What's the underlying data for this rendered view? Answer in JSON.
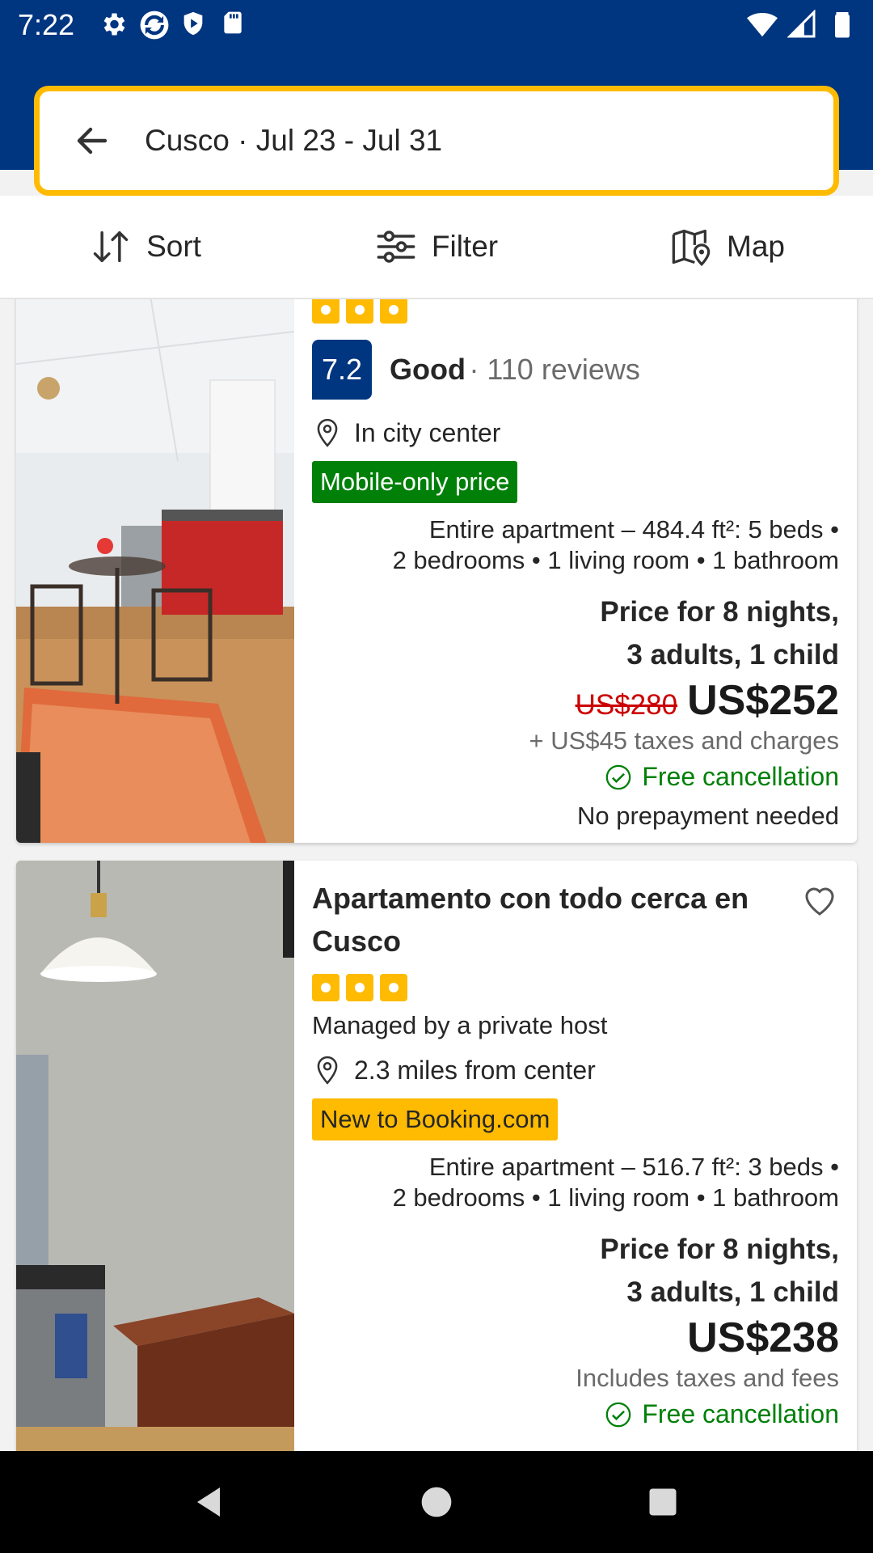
{
  "status_bar": {
    "time": "7:22",
    "left_icons": [
      "settings-icon",
      "sync-icon",
      "shield-icon",
      "sd-card-icon"
    ],
    "right_icons": [
      "wifi-icon",
      "signal-icon",
      "battery-icon"
    ]
  },
  "search": {
    "value": "Cusco · Jul 23 - Jul 31"
  },
  "toolbar": {
    "sort_label": "Sort",
    "filter_label": "Filter",
    "map_label": "Map"
  },
  "colors": {
    "brand_blue": "#003580",
    "accent_yellow": "#febb02",
    "green": "#008009",
    "red": "#cc0000"
  },
  "listings": [
    {
      "stars": 3,
      "score": "7.2",
      "score_word": "Good",
      "reviews": "· 110 reviews",
      "location": "In city center",
      "badge": "Mobile-only price",
      "details_line1": "Entire apartment – 484.4 ft²: 5 beds •",
      "details_line2": "2 bedrooms • 1 living room • 1 bathroom",
      "price_for_line1": "Price for 8 nights,",
      "price_for_line2": "3 adults, 1 child",
      "old_price": "US$280",
      "price": "US$252",
      "taxes": "+ US$45 taxes and charges",
      "cancellation": "Free cancellation",
      "prepayment": "No prepayment needed"
    },
    {
      "title": "Apartamento con todo cerca en Cusco",
      "stars": 3,
      "managed_by": "Managed by a private host",
      "location": "2.3 miles from center",
      "badge": "New to Booking.com",
      "details_line1": "Entire apartment – 516.7 ft²: 3 beds •",
      "details_line2": "2 bedrooms • 1 living room • 1 bathroom",
      "price_for_line1": "Price for 8 nights,",
      "price_for_line2": "3 adults, 1 child",
      "price": "US$238",
      "taxes": "Includes taxes and fees",
      "cancellation": "Free cancellation"
    }
  ],
  "nav_bar": {
    "buttons": [
      "back-triangle-icon",
      "home-circle-icon",
      "recents-square-icon"
    ]
  }
}
